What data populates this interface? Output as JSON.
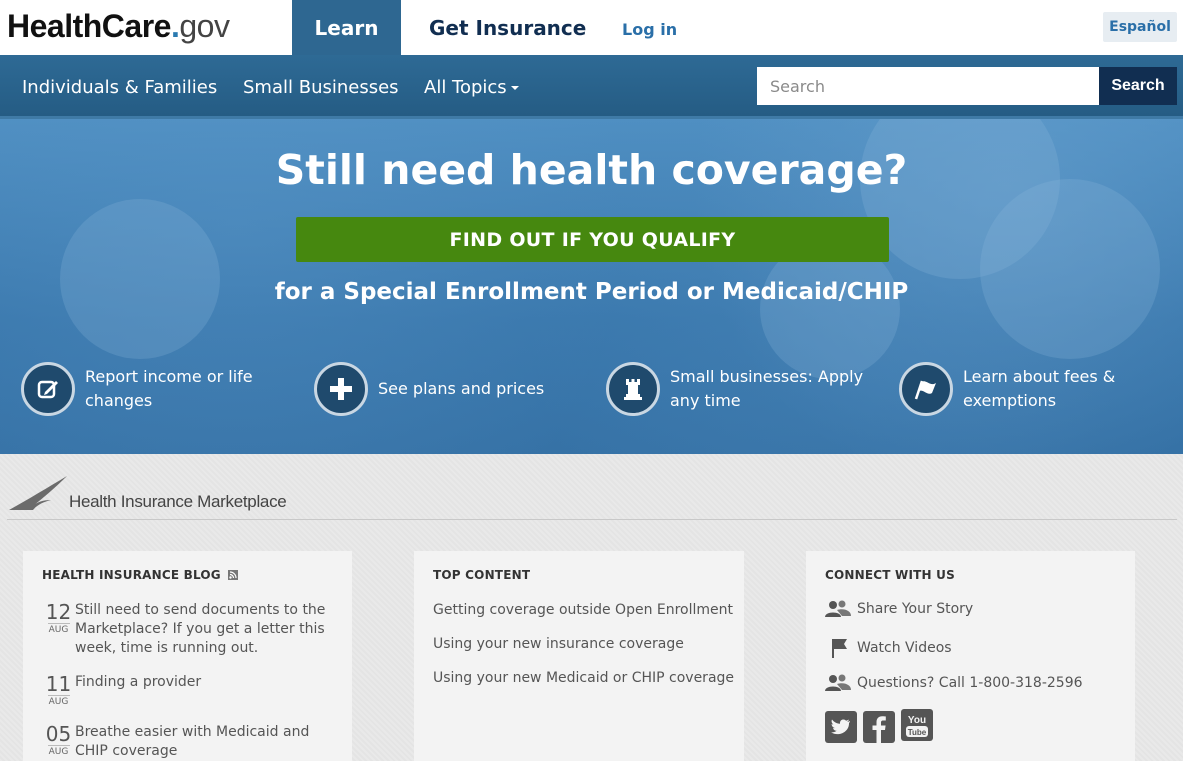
{
  "header": {
    "logo": {
      "part1": "HealthCare",
      "part2": "gov"
    },
    "tabs": [
      {
        "label": "Learn",
        "active": true
      },
      {
        "label": "Get Insurance",
        "active": false
      }
    ],
    "login_label": "Log in",
    "language_label": "Español"
  },
  "nav": {
    "items": [
      {
        "label": "Individuals & Families"
      },
      {
        "label": "Small Businesses"
      },
      {
        "label": "All Topics"
      }
    ],
    "search": {
      "placeholder": "Search",
      "button_label": "Search"
    }
  },
  "hero": {
    "title": "Still need health coverage?",
    "cta_label": "FIND OUT IF YOU QUALIFY",
    "subtitle": "for a Special Enrollment Period or Medicaid/CHIP",
    "features": [
      {
        "icon": "edit-icon",
        "line1": "Report income or life",
        "line2": "changes"
      },
      {
        "icon": "plus-icon",
        "line1": "See plans and prices",
        "line2": ""
      },
      {
        "icon": "chess-rook-icon",
        "line1": "Small businesses: Apply",
        "line2": "any time"
      },
      {
        "icon": "flag-icon",
        "line1": "Learn about fees &",
        "line2": "exemptions"
      }
    ]
  },
  "marketplace_logo_text": "Health Insurance Marketplace",
  "blog": {
    "title": "HEALTH INSURANCE BLOG",
    "items": [
      {
        "day": "12",
        "month": "AUG",
        "text": "Still need to send documents to the Marketplace? If you get a letter this week, time is running out."
      },
      {
        "day": "11",
        "month": "AUG",
        "text": "Finding a provider"
      },
      {
        "day": "05",
        "month": "AUG",
        "text": "Breathe easier with Medicaid and CHIP coverage"
      }
    ]
  },
  "top_content": {
    "title": "TOP CONTENT",
    "links": [
      "Getting coverage outside Open Enrollment",
      "Using your new insurance coverage",
      "Using your new Medicaid or CHIP coverage"
    ]
  },
  "connect": {
    "title": "CONNECT WITH US",
    "items": [
      {
        "icon": "people-icon",
        "label": "Share Your Story"
      },
      {
        "icon": "flag-icon",
        "label": "Watch Videos"
      },
      {
        "icon": "people-icon",
        "label": "Questions? Call 1-800-318-2596"
      }
    ],
    "social": [
      "twitter-icon",
      "facebook-icon",
      "youtube-icon"
    ]
  },
  "colors": {
    "brand_navy": "#112e51",
    "nav_blue": "#2e6791",
    "cta_green": "#46880f",
    "link_blue": "#2a6fa8"
  }
}
